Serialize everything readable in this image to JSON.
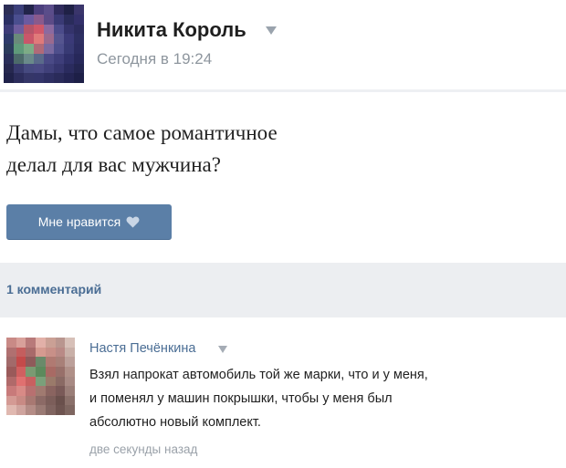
{
  "post": {
    "author_name": "Никита Король",
    "timestamp": "Сегодня в 19:24",
    "text_line1": "Дамы, что самое романтичное",
    "text_line2": "делал для вас мужчина?",
    "like_label": "Мне нравится"
  },
  "comments_summary": {
    "count_label": "1 комментарий"
  },
  "comment": {
    "author_name": "Настя Печёнкина",
    "text_line1": "Взял напрокат автомобиль той же марки, что и у меня,",
    "text_line2": "и поменял у машин покрышки, чтобы у меня был",
    "text_line3": "абсолютно новый комплект.",
    "timestamp": "две секунды назад"
  },
  "colors": {
    "accent": "#5b7fa7",
    "link": "#4a6d94",
    "muted_text": "#8e969e",
    "band_background": "#eceef1"
  },
  "icons": {
    "like": "heart-icon",
    "author_menu": "chevron-down-icon",
    "comment_menu": "chevron-down-icon"
  }
}
